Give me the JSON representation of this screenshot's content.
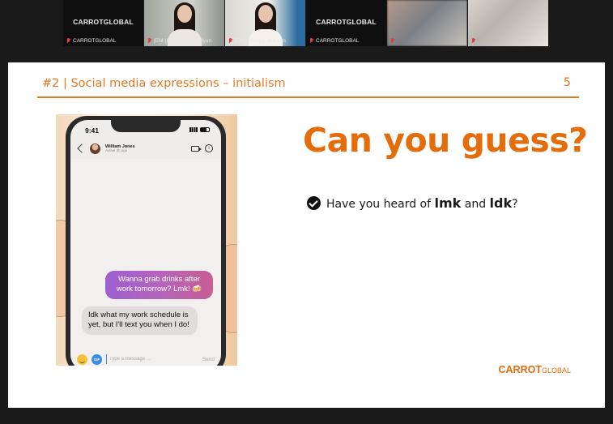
{
  "participants": [
    {
      "brand": "CARROTGLOBAL",
      "name": "CARROTGLOBAL",
      "kind": "logo",
      "active": false
    },
    {
      "brand": "",
      "name": "[EM (Group)] Shay Hyun",
      "kind": "person",
      "active": true
    },
    {
      "brand": "",
      "name": "[EM (Group)] Mia Kim",
      "kind": "person",
      "active": false
    },
    {
      "brand": "CARROTGLOBAL",
      "name": "CARROTGLOBAL",
      "kind": "logo",
      "active": false
    },
    {
      "brand": "",
      "name": "",
      "kind": "blurred",
      "active": false
    },
    {
      "brand": "",
      "name": "",
      "kind": "blurred",
      "active": false
    }
  ],
  "slide": {
    "title": "#2 | Social media expressions – initialism",
    "number": "5",
    "headline": "Can you guess?",
    "bullet": {
      "prefix": "Have you heard of ",
      "term1": "lmk",
      "middle": " and ",
      "term2": "ldk",
      "suffix": "?"
    },
    "brand": {
      "main": "CARROT",
      "sub": "GLOBAL"
    },
    "accent_color": "#e87722"
  },
  "phone": {
    "time": "9:41",
    "contact_name": "William Jones",
    "contact_status": "Active 4h ago",
    "outgoing_message": "Wanna grab drinks after work tomorrow? Lmk! 🍻",
    "incoming_message": "Idk what my work schedule is yet, but I'll text you when I do!",
    "input_placeholder": "Type a message ...",
    "send_label": "Send",
    "gif_label": "GIF",
    "info_label": "i"
  }
}
